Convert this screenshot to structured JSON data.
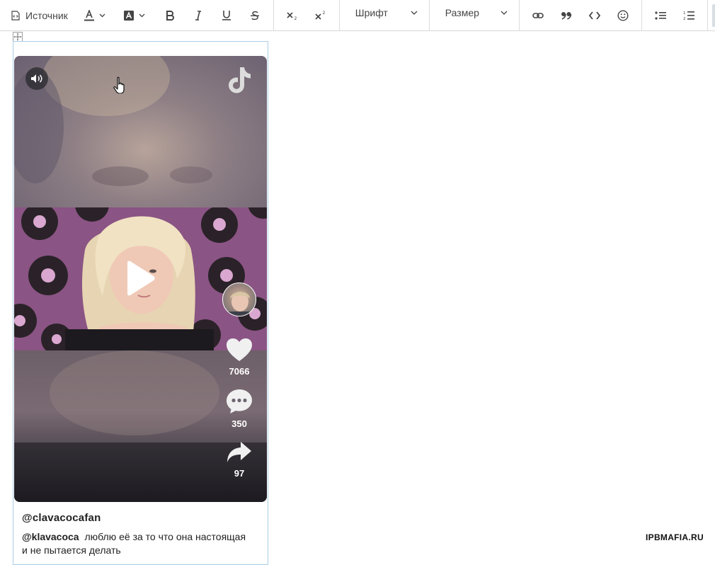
{
  "toolbar": {
    "source_label": "Источник",
    "font_label": "Шрифт",
    "size_label": "Размер"
  },
  "tiktok": {
    "likes": "7066",
    "comments": "350",
    "shares": "97",
    "author": "@clavacocafan",
    "mention": "@klavacoca",
    "caption_text": "люблю её за то что она настоящая и не пытается делать"
  },
  "watermark": "IPBMAFIA.RU",
  "colors": {
    "embed_border": "#a9cde6",
    "active_button_bg": "#d9dee3"
  }
}
